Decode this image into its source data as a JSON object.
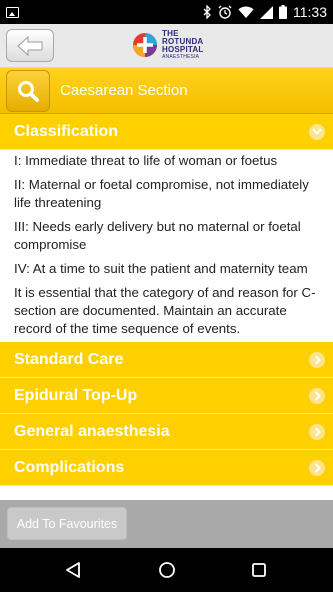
{
  "status_bar": {
    "time": "11:33",
    "icons": [
      "image-notification-icon",
      "bluetooth-icon",
      "alarm-icon",
      "wifi-icon",
      "signal-icon",
      "battery-icon"
    ]
  },
  "header": {
    "back_icon": "back-arrow-icon",
    "logo": {
      "line1": "THE",
      "line2": "ROTUNDA",
      "line3": "HOSPITAL",
      "line4": "ANAESTHESIA"
    }
  },
  "search": {
    "icon": "search-icon",
    "title": "Caesarean Section"
  },
  "sections": [
    {
      "label": "Classification",
      "expanded": true,
      "items": [
        "I: Immediate threat to life of woman or foetus",
        "II: Maternal or foetal compromise, not immediately life threatening",
        "III: Needs early delivery but no maternal or foetal compromise",
        "IV: At a time to suit the patient and maternity team",
        "It is essential that the category of and reason for C-section are documented. Maintain an accurate record of the time sequence of events."
      ]
    },
    {
      "label": "Standard Care",
      "expanded": false
    },
    {
      "label": "Epidural Top-Up",
      "expanded": false
    },
    {
      "label": "General anaesthesia",
      "expanded": false
    },
    {
      "label": "Complications",
      "expanded": false
    }
  ],
  "actions": {
    "favourites_label": "Add To Favourites"
  },
  "nav": {
    "icons": [
      "nav-back-icon",
      "nav-home-icon",
      "nav-recents-icon"
    ]
  },
  "colors": {
    "accent": "#ffd000",
    "header_bg": "#e9e9e9",
    "bottom_bg": "#a9a9a9"
  }
}
